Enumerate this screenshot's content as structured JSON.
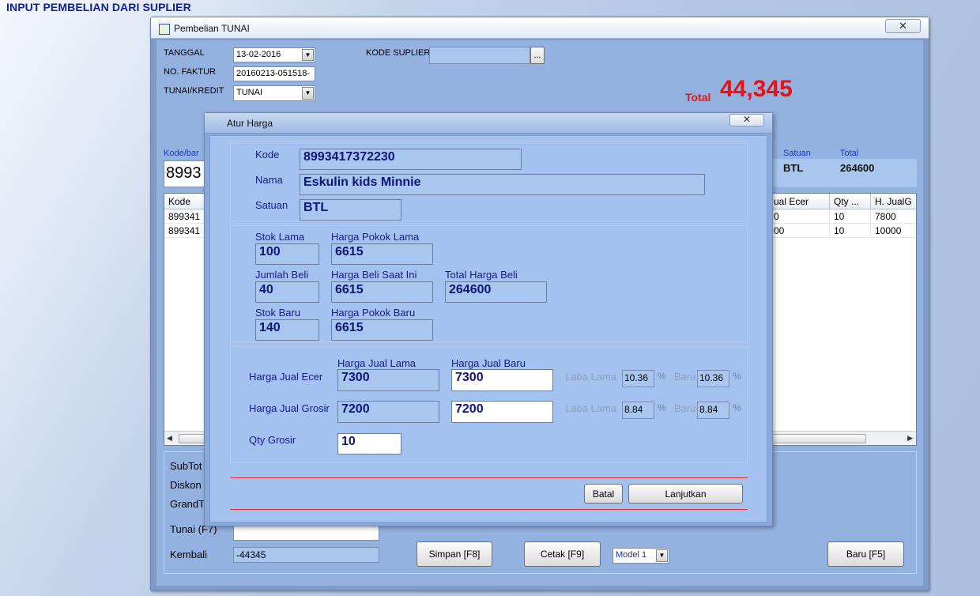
{
  "page_title": "INPUT PEMBELIAN DARI SUPLIER",
  "window": {
    "title": "Pembelian TUNAI",
    "close_glyph": "✕",
    "tanggal_label": "TANGGAL",
    "tanggal_value": "13-02-2016",
    "no_faktur_label": "NO. FAKTUR",
    "no_faktur_value": "20160213-051518-",
    "tunai_kredit_label": "TUNAI/KREDIT",
    "tunai_kredit_value": "TUNAI",
    "kode_suplier_label": "KODE SUPLIER",
    "kode_suplier_value": "",
    "browse_label": "...",
    "total_label": "Total",
    "total_value": "44,345",
    "kode_barang_label": "Kode/bar",
    "kode_barang_value": "8993",
    "satuan_label": "Satuan",
    "satuan_value": "BTL",
    "total_col_label": "Total",
    "total_col_value": "264600"
  },
  "grid": {
    "headers": {
      "kode": "Kode",
      "jual_ecer": "ual Ecer",
      "qty": "Qty ...",
      "h_jual": "H. JualG"
    },
    "rows": [
      {
        "kode": "899341",
        "jual_ecer": "0",
        "qty": "10",
        "h_jual": "7800"
      },
      {
        "kode": "899341",
        "jual_ecer": "00",
        "qty": "10",
        "h_jual": "10000"
      }
    ]
  },
  "bottom": {
    "subtotal_label": "SubTot",
    "diskon_label": "Diskon",
    "grandtotal_label": "GrandT",
    "tunai_label": "Tunai (F7)",
    "tunai_value": "",
    "kembali_label": "Kembali",
    "kembali_value": "-44345",
    "simpan_label": "Simpan [F8]",
    "cetak_label": "Cetak [F9]",
    "model_value": "Model 1",
    "baru_label": "Baru [F5]"
  },
  "dialog": {
    "title": "Atur Harga",
    "close_glyph": "✕",
    "kode_label": "Kode",
    "kode_value": "8993417372230",
    "nama_label": "Nama",
    "nama_value": "Eskulin kids Minnie",
    "satuan_label": "Satuan",
    "satuan_value": "BTL",
    "stok_lama_label": "Stok Lama",
    "stok_lama_value": "100",
    "harga_pokok_lama_label": "Harga Pokok Lama",
    "harga_pokok_lama_value": "6615",
    "jumlah_beli_label": "Jumlah Beli",
    "jumlah_beli_value": "40",
    "harga_beli_label": "Harga Beli Saat Ini",
    "harga_beli_value": "6615",
    "total_harga_beli_label": "Total Harga Beli",
    "total_harga_beli_value": "264600",
    "stok_baru_label": "Stok Baru",
    "stok_baru_value": "140",
    "harga_pokok_baru_label": "Harga Pokok Baru",
    "harga_pokok_baru_value": "6615",
    "harga_jual_lama_label": "Harga Jual Lama",
    "harga_jual_baru_label": "Harga Jual Baru",
    "ecer_label": "Harga Jual Ecer",
    "ecer_lama_value": "7300",
    "ecer_baru_value": "7300",
    "grosir_label": "Harga Jual Grosir",
    "grosir_lama_value": "7200",
    "grosir_baru_value": "7200",
    "laba_lama_label": "Laba Lama",
    "baru_label": "Baru",
    "percent": "%",
    "ecer_laba_lama": "10.36",
    "ecer_laba_baru": "10.36",
    "grosir_laba_lama": "8.84",
    "grosir_laba_baru": "8.84",
    "qty_grosir_label": "Qty Grosir",
    "qty_grosir_value": "10",
    "batal_label": "Batal",
    "lanjutkan_label": "Lanjutkan"
  },
  "colors": {
    "accent_red": "#ee0f0f",
    "title_blue": "#0e1ea0",
    "dialog_bg": "#a3c2ef"
  }
}
